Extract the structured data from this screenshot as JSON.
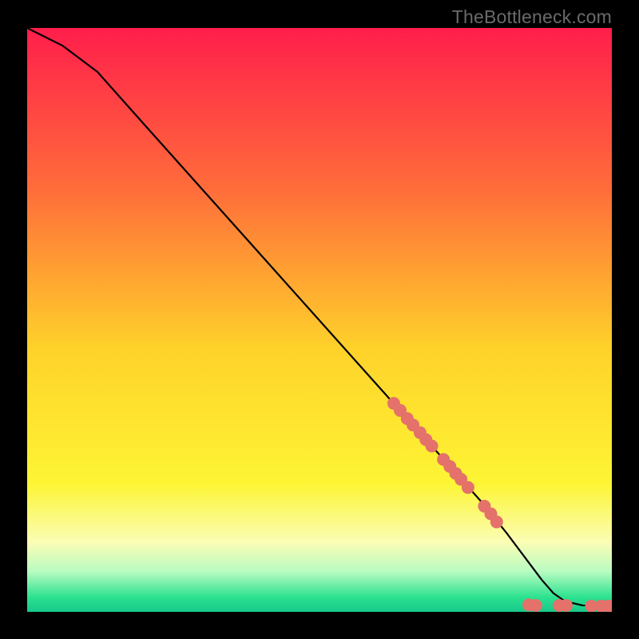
{
  "watermark": "TheBottleneck.com",
  "chart_data": {
    "type": "line",
    "title": "",
    "xlabel": "",
    "ylabel": "",
    "xlim": [
      0,
      100
    ],
    "ylim": [
      0,
      100
    ],
    "grid": false,
    "legend": false,
    "background_gradient": {
      "stops": [
        {
          "pos": 0.0,
          "color": "#FF1E4B"
        },
        {
          "pos": 0.28,
          "color": "#FF6E3A"
        },
        {
          "pos": 0.55,
          "color": "#FFD22A"
        },
        {
          "pos": 0.78,
          "color": "#FDF534"
        },
        {
          "pos": 0.88,
          "color": "#FBFDB4"
        },
        {
          "pos": 0.93,
          "color": "#BAFCC2"
        },
        {
          "pos": 0.975,
          "color": "#2CE28F"
        },
        {
          "pos": 1.0,
          "color": "#17C98A"
        }
      ]
    },
    "series": [
      {
        "name": "curve",
        "type": "line",
        "color": "#000000",
        "x": [
          0,
          6,
          12,
          20,
          30,
          40,
          50,
          60,
          70,
          78,
          82,
          85,
          88,
          90,
          92,
          95,
          100
        ],
        "y": [
          100,
          97,
          92.5,
          83.5,
          72.3,
          61.1,
          49.9,
          38.7,
          27.5,
          18.5,
          13.5,
          9.5,
          5.5,
          3.2,
          1.8,
          1.1,
          1.0
        ]
      },
      {
        "name": "markers",
        "type": "scatter",
        "color": "#E4716A",
        "radius": 8,
        "points": [
          {
            "x": 62.7,
            "y": 35.7
          },
          {
            "x": 63.8,
            "y": 34.5
          },
          {
            "x": 65.0,
            "y": 33.1
          },
          {
            "x": 66.0,
            "y": 32.0
          },
          {
            "x": 67.2,
            "y": 30.7
          },
          {
            "x": 68.2,
            "y": 29.5
          },
          {
            "x": 69.2,
            "y": 28.4
          },
          {
            "x": 71.2,
            "y": 26.1
          },
          {
            "x": 72.3,
            "y": 24.9
          },
          {
            "x": 73.3,
            "y": 23.7
          },
          {
            "x": 74.2,
            "y": 22.7
          },
          {
            "x": 75.4,
            "y": 21.3
          },
          {
            "x": 78.2,
            "y": 18.1
          },
          {
            "x": 79.3,
            "y": 16.8
          },
          {
            "x": 80.3,
            "y": 15.4
          },
          {
            "x": 85.8,
            "y": 1.2
          },
          {
            "x": 87.0,
            "y": 1.1
          },
          {
            "x": 91.0,
            "y": 1.1
          },
          {
            "x": 92.2,
            "y": 1.1
          },
          {
            "x": 96.5,
            "y": 1.0
          },
          {
            "x": 98.2,
            "y": 1.0
          },
          {
            "x": 99.4,
            "y": 1.0
          }
        ]
      }
    ]
  }
}
